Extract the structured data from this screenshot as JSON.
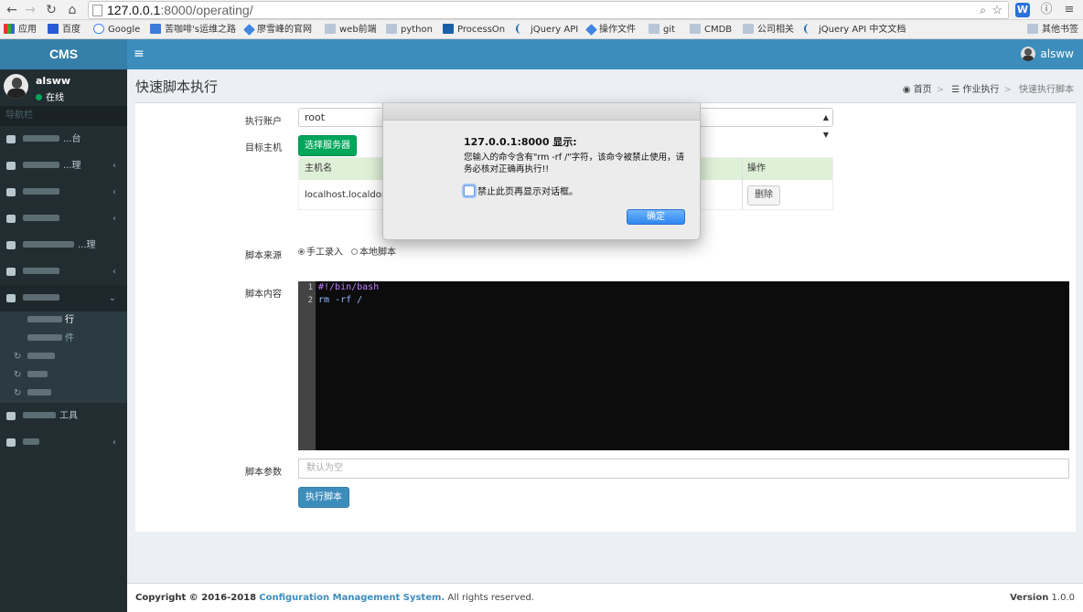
{
  "browser": {
    "url_host": "127.0.0.1",
    "url_rest": ":8000/operating/",
    "bookmarks": [
      {
        "label": "应用",
        "icon": "apps-icon"
      },
      {
        "label": "百度",
        "icon": "baidu-icon"
      },
      {
        "label": "Google",
        "icon": "google-icon"
      },
      {
        "label": "苦咖啡's运维之路",
        "icon": "page-icon"
      },
      {
        "label": "廖雪峰的官网",
        "icon": "rocket-icon"
      },
      {
        "label": "web前端",
        "icon": "folder-icon"
      },
      {
        "label": "python",
        "icon": "folder-icon"
      },
      {
        "label": "ProcessOn",
        "icon": "processon-icon"
      },
      {
        "label": "jQuery API",
        "icon": "jquery-icon"
      },
      {
        "label": "操作文件",
        "icon": "rocket-icon"
      },
      {
        "label": "git",
        "icon": "folder-icon"
      },
      {
        "label": "CMDB",
        "icon": "folder-icon"
      },
      {
        "label": "公司相关",
        "icon": "folder-icon"
      },
      {
        "label": "jQuery API 中文文档",
        "icon": "jquery-icon"
      },
      {
        "label": "其他书签",
        "icon": "folder-icon"
      }
    ]
  },
  "header": {
    "logo": "CMS",
    "toggle_icon": "≡",
    "username": "alsww"
  },
  "sidebar": {
    "user_name": "alsww",
    "user_status": "在线",
    "nav_header": "导航栏",
    "items": [
      {
        "label": "...台",
        "has_chevron": false
      },
      {
        "label": "...理",
        "has_chevron": true
      },
      {
        "label": "...",
        "has_chevron": true
      },
      {
        "label": "...",
        "has_chevron": true
      },
      {
        "label": "...理",
        "has_chevron": false
      },
      {
        "label": "...",
        "has_chevron": true
      },
      {
        "label": "...",
        "has_chevron": false
      }
    ],
    "submenu": [
      {
        "label": "行"
      },
      {
        "label": "件"
      },
      {
        "label": ""
      },
      {
        "label": ""
      },
      {
        "label": ""
      }
    ],
    "tools_item": "工具"
  },
  "page": {
    "title": "快速脚本执行",
    "breadcrumb": [
      "首页",
      "作业执行",
      "快速执行脚本"
    ]
  },
  "form": {
    "account_label": "执行账户",
    "account_value": "root",
    "target_label": "目标主机",
    "select_server_button": "选择服务器",
    "table_headers": [
      "主机名",
      "操作"
    ],
    "table_rows": [
      {
        "host": "localhost.localdoma",
        "action": "删除"
      }
    ],
    "source_label": "脚本来源",
    "source_options": [
      "手工录入",
      "本地脚本"
    ],
    "source_selected": "手工录入",
    "content_label": "脚本内容",
    "code_lines": [
      {
        "num": "1",
        "text": "#!/bin/bash"
      },
      {
        "num": "2",
        "text": "rm -rf /"
      }
    ],
    "params_label": "脚本参数",
    "params_placeholder": "默认为空",
    "run_button": "执行脚本"
  },
  "footer": {
    "copyright_prefix": "Copyright © 2016-2018",
    "company": "Configuration Management System.",
    "rights": "All rights reserved.",
    "version_label": "Version",
    "version_value": "1.0.0"
  },
  "dialog": {
    "title": "127.0.0.1:8000 显示:",
    "message": "您输入的命令含有\"rm -rf /\"字符，该命令被禁止使用，请务必核对正确再执行!!",
    "checkbox_label": "禁止此页再显示对话框。",
    "ok_button": "确定"
  },
  "colors": {
    "header_blue": "#3c8dbc",
    "sidebar_dark": "#222d32",
    "success_green": "#00a65a",
    "editor_bg": "#0c0c0c"
  }
}
